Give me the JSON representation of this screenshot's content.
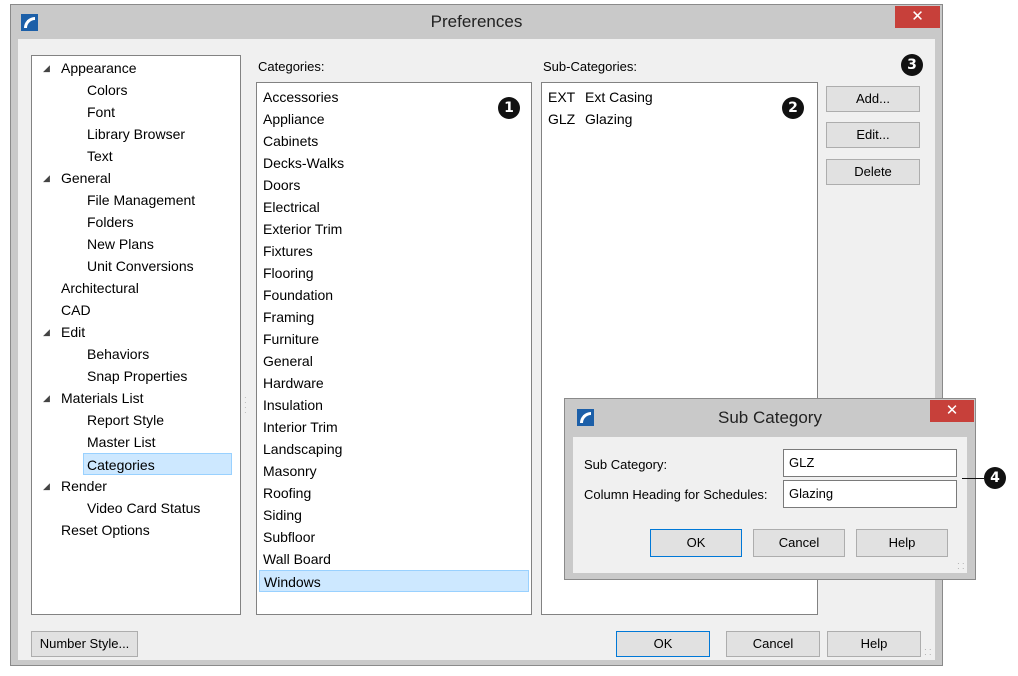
{
  "window": {
    "title": "Preferences",
    "close_glyph": "✕"
  },
  "tree": {
    "items": [
      {
        "label": "Appearance",
        "expanded": true
      },
      {
        "label": "Colors"
      },
      {
        "label": "Font"
      },
      {
        "label": "Library Browser"
      },
      {
        "label": "Text"
      },
      {
        "label": "General",
        "expanded": true
      },
      {
        "label": "File Management"
      },
      {
        "label": "Folders"
      },
      {
        "label": "New Plans"
      },
      {
        "label": "Unit Conversions"
      },
      {
        "label": "Architectural"
      },
      {
        "label": "CAD"
      },
      {
        "label": "Edit",
        "expanded": true
      },
      {
        "label": "Behaviors"
      },
      {
        "label": "Snap Properties"
      },
      {
        "label": "Materials List",
        "expanded": true
      },
      {
        "label": "Report Style"
      },
      {
        "label": "Master List"
      },
      {
        "label": "Categories",
        "selected": true
      },
      {
        "label": "Render",
        "expanded": true
      },
      {
        "label": "Video Card Status"
      },
      {
        "label": "Reset Options"
      }
    ],
    "expand_glyph": "◢"
  },
  "categories": {
    "label": "Categories:",
    "items": [
      "Accessories",
      "Appliance",
      "Cabinets",
      "Decks-Walks",
      "Doors",
      "Electrical",
      "Exterior Trim",
      "Fixtures",
      "Flooring",
      "Foundation",
      "Framing",
      "Furniture",
      "General",
      "Hardware",
      "Insulation",
      "Interior Trim",
      "Landscaping",
      "Masonry",
      "Roofing",
      "Siding",
      "Subfloor",
      "Wall Board",
      "Windows"
    ],
    "selected": "Windows"
  },
  "subcategories": {
    "label": "Sub-Categories:",
    "items": [
      {
        "code": "EXT",
        "name": "Ext Casing"
      },
      {
        "code": "GLZ",
        "name": "Glazing"
      }
    ]
  },
  "side_buttons": {
    "add": "Add...",
    "edit": "Edit...",
    "delete": "Delete"
  },
  "footer": {
    "number_style": "Number Style...",
    "ok": "OK",
    "cancel": "Cancel",
    "help": "Help"
  },
  "markers": [
    "1",
    "2",
    "3",
    "4"
  ],
  "sub_dialog": {
    "title": "Sub Category",
    "close_glyph": "✕",
    "sub_category_label": "Sub Category:",
    "sub_category_value": "GLZ",
    "column_heading_label": "Column Heading for Schedules:",
    "column_heading_value": "Glazing",
    "ok": "OK",
    "cancel": "Cancel",
    "help": "Help"
  },
  "colors": {
    "close_red": "#c7403a",
    "selection": "#cde8ff",
    "default_button_border": "#0078d7",
    "app_icon": "#1c5fa8"
  }
}
